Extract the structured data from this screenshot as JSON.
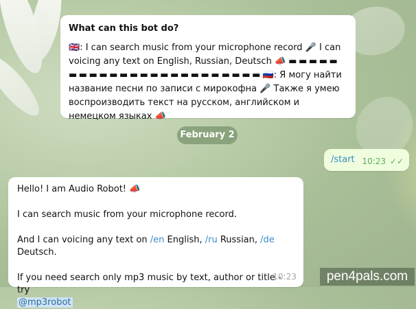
{
  "intro": {
    "title": "What can this bot do?",
    "flag_uk": "🇬🇧",
    "line1": ": I can search music from your microphone record",
    "mic1": "🎤",
    "line1b": " I can voicing any text on English, Russian, Deutsch",
    "speaker1": "📣",
    "dashes1": "▬ ▬ ▬ ▬ ▬",
    "dashes2": "▬ ▬ ▬ ▬ ▬ ▬ ▬ ▬ ▬ ▬ ▬ ▬ ▬ ▬ ▬",
    "dashes3": "▬ ▬ ▬ ▬",
    "flag_ru": "🇷🇺",
    "line_ru1": ": Я могу найти название песни по записи с мирокофна",
    "mic2": "🎤",
    "line_ru2": " Также я умею воспроизводить текст на русском, английском и немецком языках",
    "speaker2": "📣"
  },
  "date_separator": "February 2",
  "outgoing": {
    "text": "/start",
    "time": "10:23",
    "ticks": "✓✓"
  },
  "incoming": {
    "greeting": "Hello! I am Audio Robot!",
    "speaker": "📣",
    "line1": "I can search music from your microphone record.",
    "line2_prefix": "And I can voicing any text on ",
    "cmd_en": "/en",
    "lang_en": " English, ",
    "cmd_ru": "/ru",
    "lang_ru": " Russian, ",
    "cmd_de": "/de",
    "lang_de": " Deutsch.",
    "line3": "If you need search only mp3 music by text, author or title - try",
    "mention": "@mp3robot",
    "time": "10:23"
  },
  "watermark": "pen4pals.com"
}
